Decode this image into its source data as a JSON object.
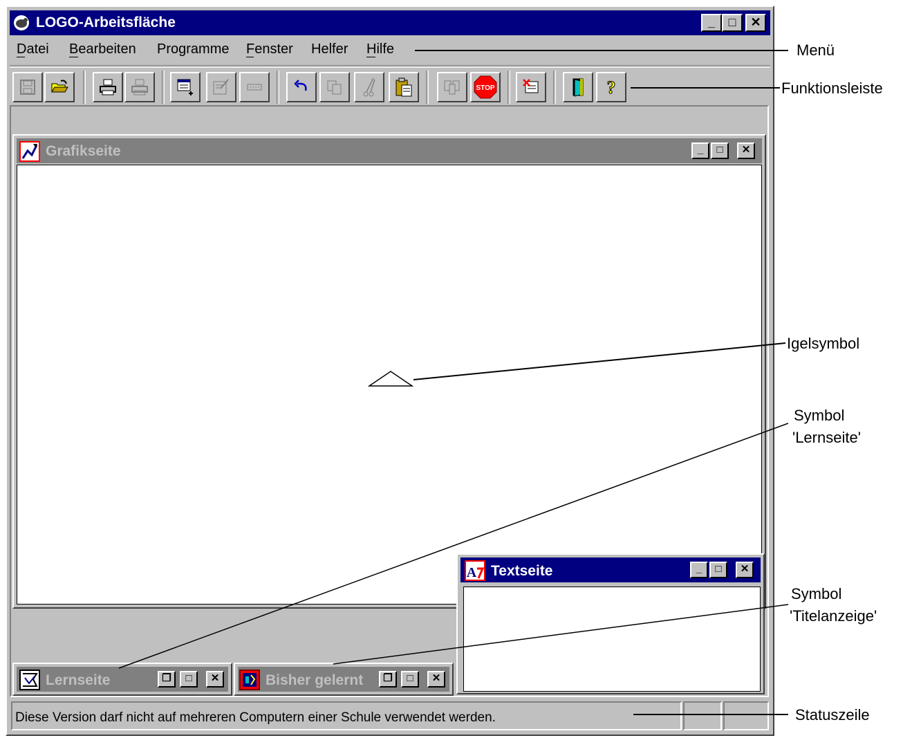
{
  "window": {
    "title": "LOGO-Arbeitsfläche",
    "caption_buttons": {
      "minimize": "_",
      "maximize": "□",
      "close": "✕"
    }
  },
  "menu": {
    "items": [
      {
        "label": "Datei",
        "accelerator": "D"
      },
      {
        "label": "Bearbeiten",
        "accelerator": "B"
      },
      {
        "label": "Programme",
        "accelerator": "P"
      },
      {
        "label": "Fenster",
        "accelerator": "F"
      },
      {
        "label": "Helfer",
        "accelerator": ""
      },
      {
        "label": "Hilfe",
        "accelerator": "H"
      }
    ]
  },
  "toolbar": {
    "buttons": [
      {
        "icon": "save-icon",
        "enabled": false
      },
      {
        "icon": "open-folder-icon",
        "enabled": true
      },
      {
        "icon": "print-icon",
        "enabled": true
      },
      {
        "icon": "print-setup-icon",
        "enabled": false
      },
      {
        "icon": "new-procedure-icon",
        "enabled": true
      },
      {
        "icon": "edit-procedure-icon",
        "enabled": false
      },
      {
        "icon": "erase-procedure-icon",
        "enabled": false
      },
      {
        "icon": "undo-icon",
        "enabled": true
      },
      {
        "icon": "copy-icon",
        "enabled": false
      },
      {
        "icon": "cut-icon",
        "enabled": false
      },
      {
        "icon": "paste-icon",
        "enabled": true
      },
      {
        "icon": "find-icon",
        "enabled": false
      },
      {
        "icon": "stop-icon",
        "enabled": true,
        "label": "STOP"
      },
      {
        "icon": "clear-icon",
        "enabled": true
      },
      {
        "icon": "exit-door-icon",
        "enabled": true
      },
      {
        "icon": "help-question-icon",
        "enabled": true,
        "label": "?"
      }
    ]
  },
  "grafikseite": {
    "title": "Grafikseite",
    "active": false
  },
  "textseite": {
    "title": "Textseite",
    "active": true
  },
  "minimized": [
    {
      "title": "Lernseite"
    },
    {
      "title": "Bisher gelernt"
    }
  ],
  "statusbar": {
    "message": "Diese Version darf nicht auf mehreren Computern einer Schule verwendet werden."
  },
  "callouts": {
    "menu": "Menü",
    "toolbar": "Funktionsleiste",
    "turtle": "Igelsymbol",
    "lernseite_line1": "Symbol",
    "lernseite_line2": "'Lernseite'",
    "titel_line1": "Symbol",
    "titel_line2": "'Titelanzeige'",
    "status": "Statuszeile"
  },
  "colors": {
    "active_title": "#000080",
    "inactive_title": "#808080",
    "face": "#c0c0c0"
  }
}
